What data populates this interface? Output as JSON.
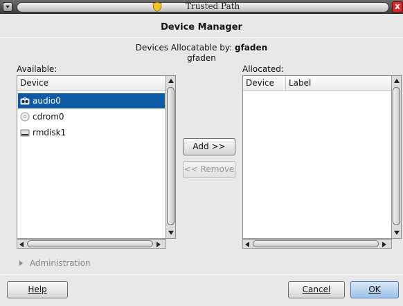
{
  "window": {
    "title": "Trusted Path",
    "close_label": "x"
  },
  "dialog": {
    "title": "Device Manager",
    "allocatable_prefix": "Devices Allocatable by:",
    "allocatable_user": "gfaden",
    "current_user": "gfaden"
  },
  "available": {
    "label": "Available:",
    "column": "Device",
    "items": [
      {
        "name": "audio0",
        "icon": "speaker-icon",
        "selected": true
      },
      {
        "name": "cdrom0",
        "icon": "cd-icon",
        "selected": false
      },
      {
        "name": "rmdisk1",
        "icon": "disk-drive-icon",
        "selected": false
      }
    ]
  },
  "allocated": {
    "label": "Allocated:",
    "columns": [
      "Device",
      "Label"
    ]
  },
  "actions": {
    "add_label": "Add >>",
    "remove_label": "<< Remove"
  },
  "administration": {
    "label": "Administration"
  },
  "footer": {
    "help_label": "Help",
    "cancel_label": "Cancel",
    "ok_label": "OK"
  },
  "colors": {
    "selection": "#0f5aa6",
    "close": "#d42a2a",
    "ok_button": "#9ec2e6"
  }
}
